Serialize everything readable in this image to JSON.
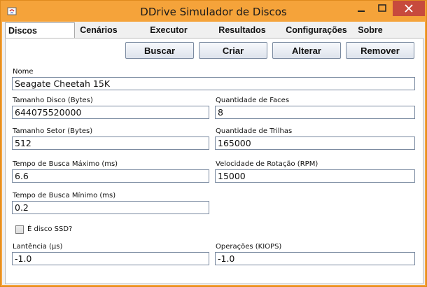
{
  "window": {
    "title": "DDrive Simulador de Discos"
  },
  "tabs": [
    {
      "label": "Discos"
    },
    {
      "label": "Cenários"
    },
    {
      "label": "Executor"
    },
    {
      "label": "Resultados"
    },
    {
      "label": "Configurações"
    },
    {
      "label": "Sobre"
    }
  ],
  "toolbar": {
    "search_label": "Buscar",
    "create_label": "Criar",
    "edit_label": "Alterar",
    "remove_label": "Remover"
  },
  "form": {
    "name_label": "Nome",
    "name_value": "Seagate Cheetah 15K",
    "disk_size_label": "Tamanho Disco (Bytes)",
    "disk_size_value": "644075520000",
    "faces_label": "Quantidade de Faces",
    "faces_value": "8",
    "sector_size_label": "Tamanho Setor (Bytes)",
    "sector_size_value": "512",
    "tracks_label": "Quantidade de Trilhas",
    "tracks_value": "165000",
    "max_seek_label": "Tempo de Busca Máximo (ms)",
    "max_seek_value": "6.6",
    "rpm_label": "Velocidade de Rotação (RPM)",
    "rpm_value": "15000",
    "min_seek_label": "Tempo de Busca Mínimo (ms)",
    "min_seek_value": "0.2",
    "ssd_label": "É disco SSD?",
    "ssd_checked": false,
    "latency_label": "Lantência (µs)",
    "latency_value": "-1.0",
    "ops_label": "Operações (KIOPS)",
    "ops_value": "-1.0"
  }
}
